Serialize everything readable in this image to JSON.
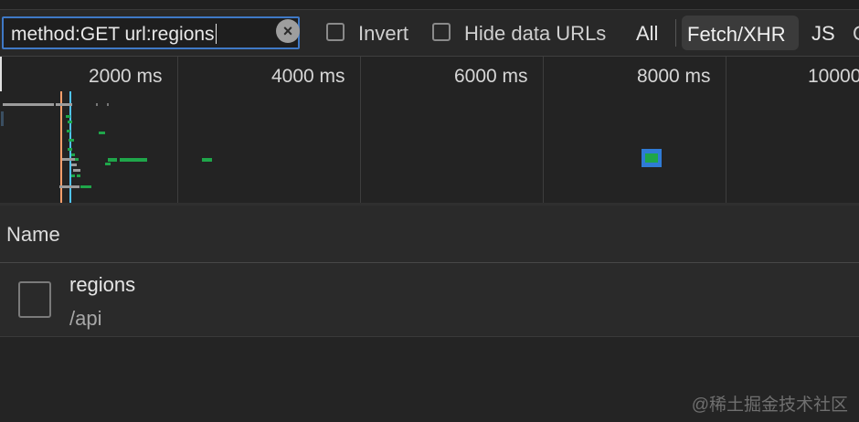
{
  "filter": {
    "query": "method:GET url:regions",
    "clear_icon": "×",
    "invert_label": "Invert",
    "hide_data_urls_label": "Hide data URLs",
    "types": [
      "All",
      "Fetch/XHR",
      "JS"
    ],
    "active_type": "Fetch/XHR",
    "truncated_next": "C"
  },
  "overview": {
    "ticks": [
      "2000 ms",
      "4000 ms",
      "6000 ms",
      "8000 ms",
      "10000"
    ],
    "colors": {
      "request": "#1fa64a",
      "queued": "#9c9c9c",
      "dom_content_loaded": "#4fc3f7",
      "load": "#ff9f6b",
      "selected": "#2f7bd6"
    }
  },
  "table": {
    "column_name": "Name",
    "rows": [
      {
        "name": "regions",
        "path": "/api",
        "icon": "document-icon"
      }
    ]
  },
  "watermark": "@稀土掘金技术社区"
}
